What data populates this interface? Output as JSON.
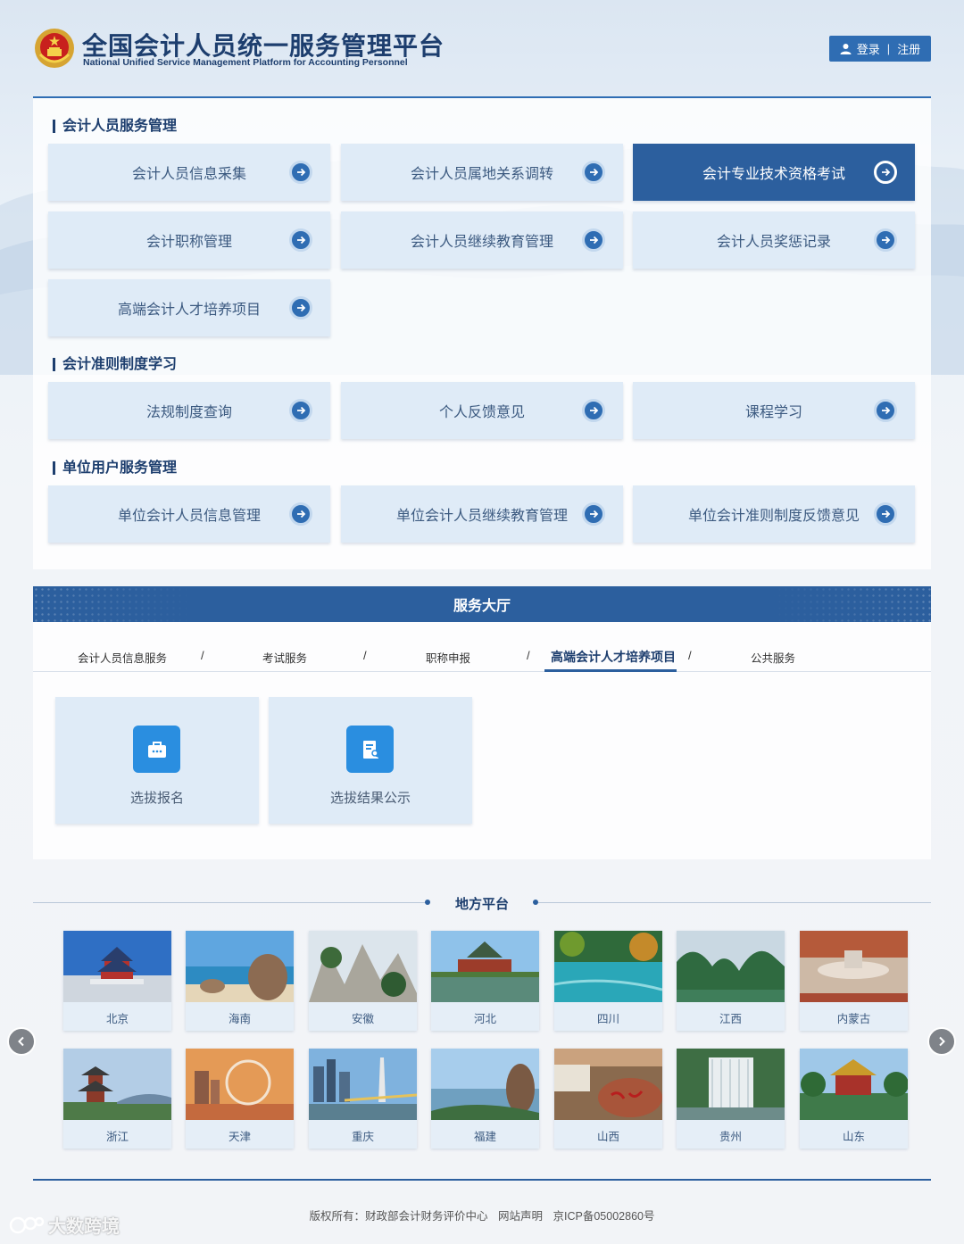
{
  "header": {
    "title_cn": "全国会计人员统一服务管理平台",
    "title_en": "National Unified Service Management Platform for Accounting Personnel",
    "login_label": "登录",
    "register_label": "注册"
  },
  "sections": [
    {
      "title": "会计人员服务管理",
      "items": [
        {
          "label": "会计人员信息采集",
          "active": false
        },
        {
          "label": "会计人员属地关系调转",
          "active": false
        },
        {
          "label": "会计专业技术资格考试",
          "active": true
        },
        {
          "label": "会计职称管理",
          "active": false
        },
        {
          "label": "会计人员继续教育管理",
          "active": false
        },
        {
          "label": "会计人员奖惩记录",
          "active": false
        },
        {
          "label": "高端会计人才培养项目",
          "active": false
        }
      ]
    },
    {
      "title": "会计准则制度学习",
      "items": [
        {
          "label": "法规制度查询"
        },
        {
          "label": "个人反馈意见"
        },
        {
          "label": "课程学习"
        }
      ]
    },
    {
      "title": "单位用户服务管理",
      "items": [
        {
          "label": "单位会计人员信息管理"
        },
        {
          "label": "单位会计人员继续教育管理"
        },
        {
          "label": "单位会计准则制度反馈意见"
        }
      ]
    }
  ],
  "service_hall": {
    "title": "服务大厅",
    "tabs": [
      {
        "label": "会计人员信息服务",
        "active": false
      },
      {
        "label": "考试服务",
        "active": false
      },
      {
        "label": "职称申报",
        "active": false
      },
      {
        "label": "高端会计人才培养项目",
        "active": true
      },
      {
        "label": "公共服务",
        "active": false
      }
    ],
    "separator": "/",
    "cards": [
      {
        "label": "选拔报名",
        "icon": "briefcase-icon"
      },
      {
        "label": "选拔结果公示",
        "icon": "document-icon"
      }
    ]
  },
  "local": {
    "title": "地方平台",
    "cities": [
      "北京",
      "海南",
      "安徽",
      "河北",
      "四川",
      "江西",
      "内蒙古",
      "浙江",
      "天津",
      "重庆",
      "福建",
      "山西",
      "贵州",
      "山东"
    ]
  },
  "footer": {
    "copyright": "版权所有：财政部会计财务评价中心",
    "statement": "网站声明",
    "icp": "京ICP备05002860号"
  },
  "watermark": "大数跨境",
  "colors": {
    "primary": "#2c5f9e",
    "title": "#1d3e6e",
    "tile_bg": "#dfebf7",
    "icon_bg": "#2a8ee0"
  }
}
